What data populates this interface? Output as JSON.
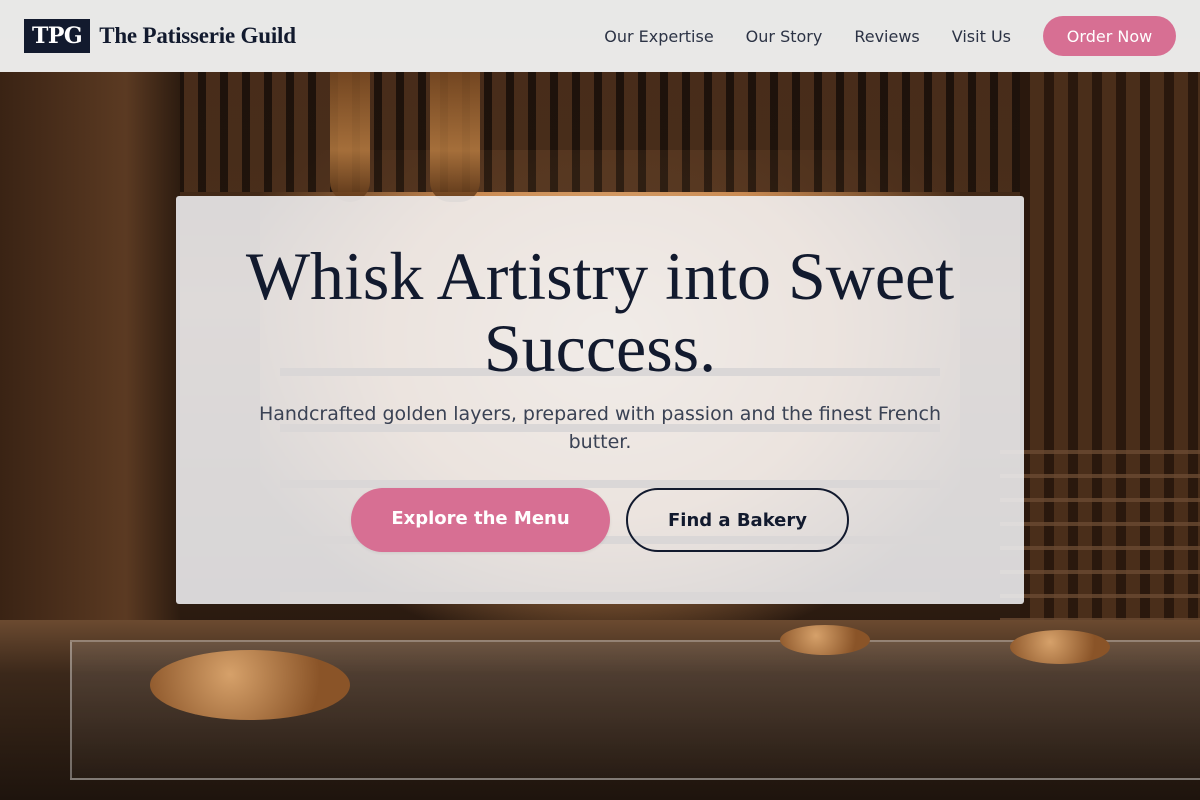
{
  "brand": {
    "mark": "TPG",
    "name": "The Patisserie Guild"
  },
  "nav": {
    "links": [
      "Our Expertise",
      "Our Story",
      "Reviews",
      "Visit Us"
    ],
    "cta": "Order Now"
  },
  "hero": {
    "title": "Whisk Artistry into Sweet Success.",
    "subtitle": "Handcrafted golden layers, prepared with passion and the finest French butter.",
    "primary_cta": "Explore the Menu",
    "secondary_cta": "Find a Bakery",
    "background_icon": "bakery-interior-photo"
  },
  "colors": {
    "accent": "#d76f93",
    "navy": "#121a2e",
    "nav_bg": "#f0f0f0"
  }
}
